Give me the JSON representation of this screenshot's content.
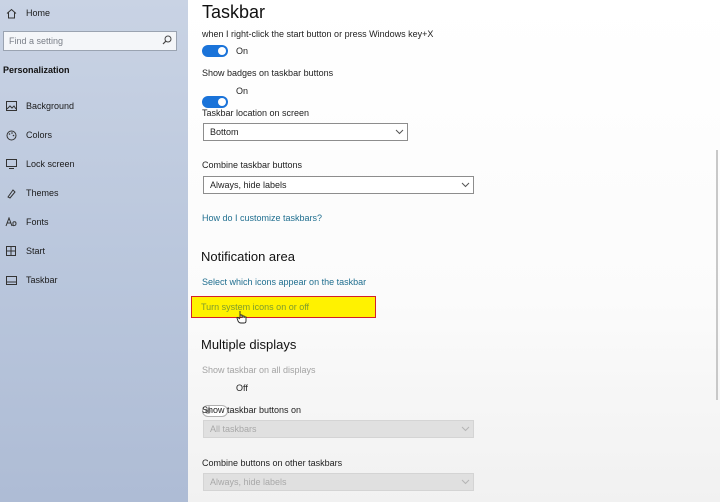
{
  "sidebar": {
    "home_label": "Home",
    "search_placeholder": "Find a setting",
    "section_label": "Personalization",
    "items": [
      {
        "label": "Background",
        "icon": "image-icon"
      },
      {
        "label": "Colors",
        "icon": "palette-icon"
      },
      {
        "label": "Lock screen",
        "icon": "lock-screen-icon"
      },
      {
        "label": "Themes",
        "icon": "themes-icon"
      },
      {
        "label": "Fonts",
        "icon": "fonts-icon"
      },
      {
        "label": "Start",
        "icon": "start-icon"
      },
      {
        "label": "Taskbar",
        "icon": "taskbar-icon"
      }
    ]
  },
  "main": {
    "title": "Taskbar",
    "partial_setting_label": "when I right-click the start button or press Windows key+X",
    "partial_toggle_state": "On",
    "badges_label": "Show badges on taskbar buttons",
    "badges_toggle_state": "On",
    "location_label": "Taskbar location on screen",
    "location_value": "Bottom",
    "combine_label": "Combine taskbar buttons",
    "combine_value": "Always, hide labels",
    "customize_link": "How do I customize taskbars?",
    "notification_heading": "Notification area",
    "select_icons_link": "Select which icons appear on the taskbar",
    "system_icons_link": "Turn system icons on or off",
    "multiple_heading": "Multiple displays",
    "show_all_label": "Show taskbar on all displays",
    "show_all_state": "Off",
    "buttons_on_label": "Show taskbar buttons on",
    "buttons_on_value": "All taskbars",
    "combine_other_label": "Combine buttons on other taskbars",
    "combine_other_value": "Always, hide labels"
  },
  "colors": {
    "toggle_on": "#1a73d9",
    "link": "#1f6e8f",
    "highlight": "#fff200",
    "highlight_border": "#d3202a"
  }
}
